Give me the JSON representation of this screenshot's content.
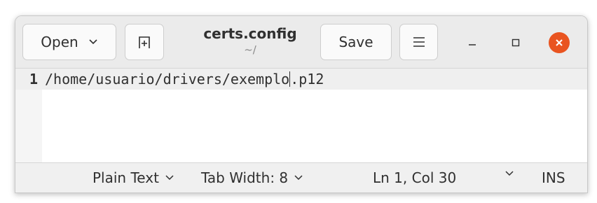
{
  "window": {
    "title": "certs.config",
    "subtitle": "~/"
  },
  "headerbar": {
    "open_label": "Open",
    "save_label": "Save"
  },
  "editor": {
    "line_number": "1",
    "text_before_cursor": "/home/usuario/drivers/exemplo",
    "text_after_cursor": ".p12"
  },
  "statusbar": {
    "language": "Plain Text",
    "tab_width": "Tab Width: 8",
    "position": "Ln 1, Col 30",
    "mode": "INS"
  },
  "colors": {
    "close_button": "#e95420",
    "header_bg": "#ebebeb",
    "current_line_bg": "#efefef"
  },
  "icons": [
    "chevron-down-icon",
    "new-tab-icon",
    "hamburger-menu-icon",
    "minimize-icon",
    "maximize-icon",
    "close-icon"
  ]
}
